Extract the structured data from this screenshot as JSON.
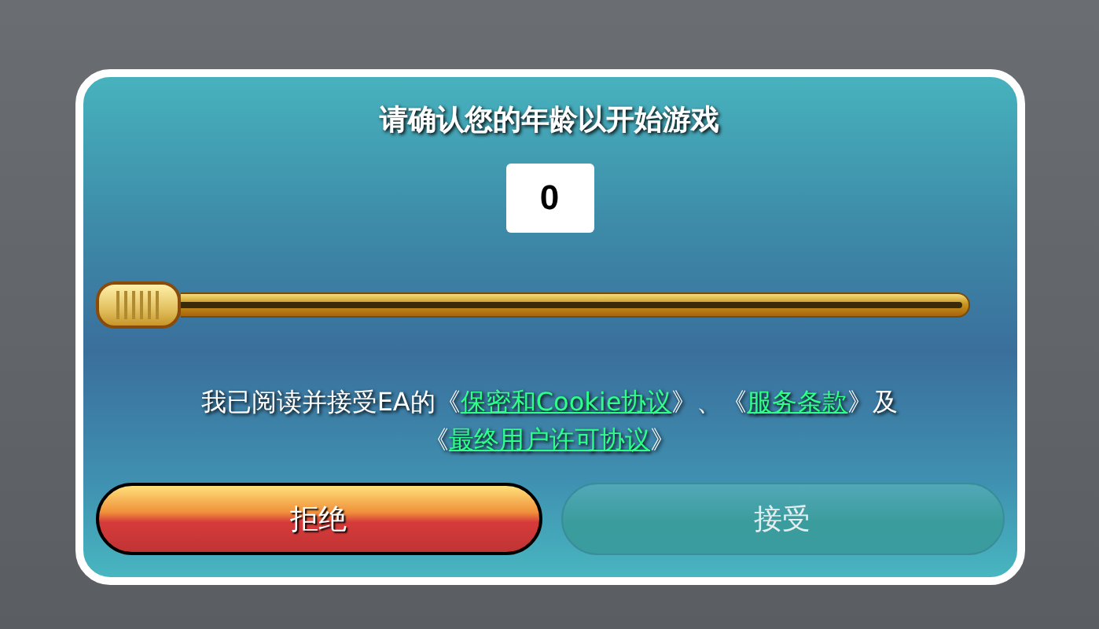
{
  "dialog": {
    "title": "请确认您的年龄以开始游戏",
    "age_field": {
      "value": "0"
    },
    "consent": [
      {
        "kind": "text",
        "text": "我已阅读并接受EA的《"
      },
      {
        "kind": "link",
        "text": "保密和Cookie协议"
      },
      {
        "kind": "text",
        "text": "》、《"
      },
      {
        "kind": "link",
        "text": "服务条款"
      },
      {
        "kind": "text",
        "text": "》及《"
      },
      {
        "kind": "link",
        "text": "最终用户许可协议"
      },
      {
        "kind": "text",
        "text": "》"
      }
    ],
    "buttons": [
      {
        "label": "拒绝",
        "kind": "decline",
        "disabled": false
      },
      {
        "label": "接受",
        "kind": "accept",
        "disabled": true
      }
    ]
  }
}
